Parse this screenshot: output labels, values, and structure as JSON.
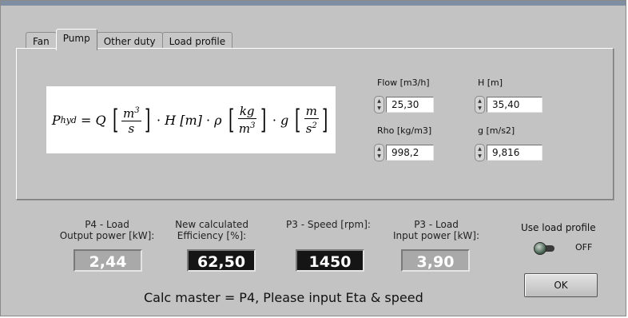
{
  "tabs": [
    {
      "label": "Fan",
      "active": false
    },
    {
      "label": "Pump",
      "active": true
    },
    {
      "label": "Other duty",
      "active": false
    },
    {
      "label": "Load profile",
      "active": false
    }
  ],
  "formula": {
    "lhs": "P",
    "lhs_sub": "hyd",
    "q": "Q",
    "q_unit_num": "m",
    "q_unit_num_exp": "3",
    "q_unit_den": "s",
    "h": "H",
    "h_unit": "[m]",
    "rho": "ρ",
    "rho_unit_num": "kg",
    "rho_unit_den": "m",
    "rho_unit_den_exp": "3",
    "g": "g",
    "g_unit_num": "m",
    "g_unit_den": "s",
    "g_unit_den_exp": "2"
  },
  "inputs": {
    "flow": {
      "label": "Flow [m3/h]",
      "value": "25,30"
    },
    "head": {
      "label": "H [m]",
      "value": "35,40"
    },
    "rho": {
      "label": "Rho [kg/m3]",
      "value": "998,2"
    },
    "g": {
      "label": "g [m/s2]",
      "value": "9,816"
    }
  },
  "indicators": {
    "p4_output": {
      "label_line1": "P4 - Load",
      "label_line2": "Output power [kW]:",
      "value": "2,44"
    },
    "efficiency": {
      "label_line1": "New calculated",
      "label_line2": "Efficiency [%]:",
      "value": "62,50"
    },
    "speed": {
      "label_line1": "",
      "label_line2": "P3 - Speed [rpm]:",
      "value": "1450"
    },
    "p3_input": {
      "label_line1": "P3 - Load",
      "label_line2": "Input power [kW]:",
      "value": "3,90"
    }
  },
  "load_profile_toggle": {
    "label": "Use load profile",
    "state": "OFF"
  },
  "ok_button": {
    "label": "OK"
  },
  "status_message": "Calc master = P4, Please input Eta & speed"
}
